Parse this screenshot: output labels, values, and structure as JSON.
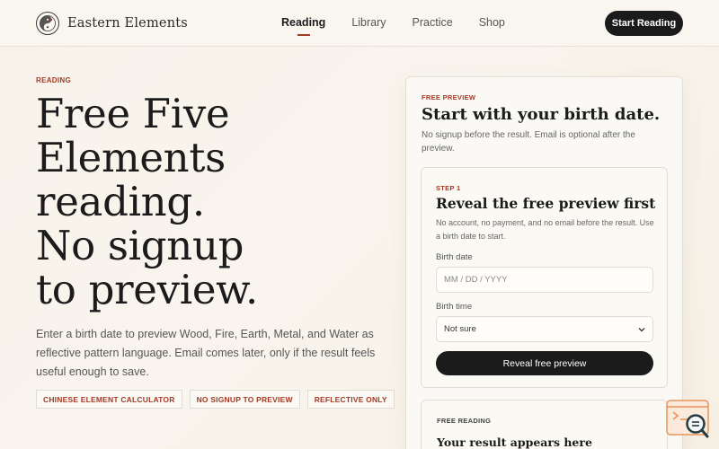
{
  "brand": {
    "name": "Eastern Elements",
    "logo_icon": "yin-yang-icon"
  },
  "nav": {
    "items": [
      {
        "label": "Reading",
        "active": true
      },
      {
        "label": "Library",
        "active": false
      },
      {
        "label": "Practice",
        "active": false
      },
      {
        "label": "Shop",
        "active": false
      }
    ],
    "cta_label": "Start Reading"
  },
  "hero": {
    "eyebrow": "READING",
    "title_lines": [
      "Free Five",
      "Elements",
      "reading.",
      "No signup",
      "to preview."
    ],
    "subtitle": "Enter a birth date to preview Wood, Fire, Earth, Metal, and Water as reflective pattern language. Email comes later, only if the result feels useful enough to save.",
    "tags": [
      "CHINESE ELEMENT CALCULATOR",
      "NO SIGNUP TO PREVIEW",
      "REFLECTIVE ONLY"
    ]
  },
  "card": {
    "eyebrow": "FREE PREVIEW",
    "title": "Start with your birth date.",
    "description": "No signup before the result. Email is optional after the preview.",
    "step": {
      "eyebrow": "STEP 1",
      "title": "Reveal the free preview first",
      "description": "No account, no payment, and no email before the result. Use a birth date to start.",
      "birth_date_label": "Birth date",
      "birth_date_placeholder": "MM / DD / YYYY",
      "birth_time_label": "Birth time",
      "birth_time_value": "Not sure",
      "submit_label": "Reveal free preview"
    },
    "result": {
      "eyebrow": "FREE READING",
      "title": "Your result appears here"
    }
  },
  "colors": {
    "accent": "#a33a26",
    "dark": "#1b1b1b",
    "background": "#f7f2ea",
    "helper_orange": "#e8955a"
  }
}
